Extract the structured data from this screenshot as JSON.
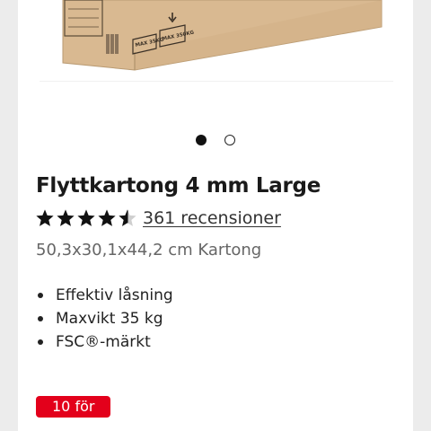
{
  "product": {
    "title": "Flyttkartong 4 mm Large",
    "rating_stars": 4.5,
    "reviews_text": "361 recensioner",
    "subtitle": "50,3x30,1x44,2 cm Kartong",
    "features": [
      "Effektiv låsning",
      "Maxvikt 35 kg",
      "FSC®-märkt"
    ],
    "badge": "10 för",
    "box_labels": [
      "MAX 35KG",
      "MAX 350KG"
    ]
  },
  "carousel": {
    "active_index": 0,
    "count": 2
  },
  "colors": {
    "badge_bg": "#e3001b",
    "box_cardboard": "#d7b88f",
    "star": "#111111"
  },
  "icons": [
    "star-icon",
    "half-star-icon",
    "stack-weight-icon"
  ]
}
